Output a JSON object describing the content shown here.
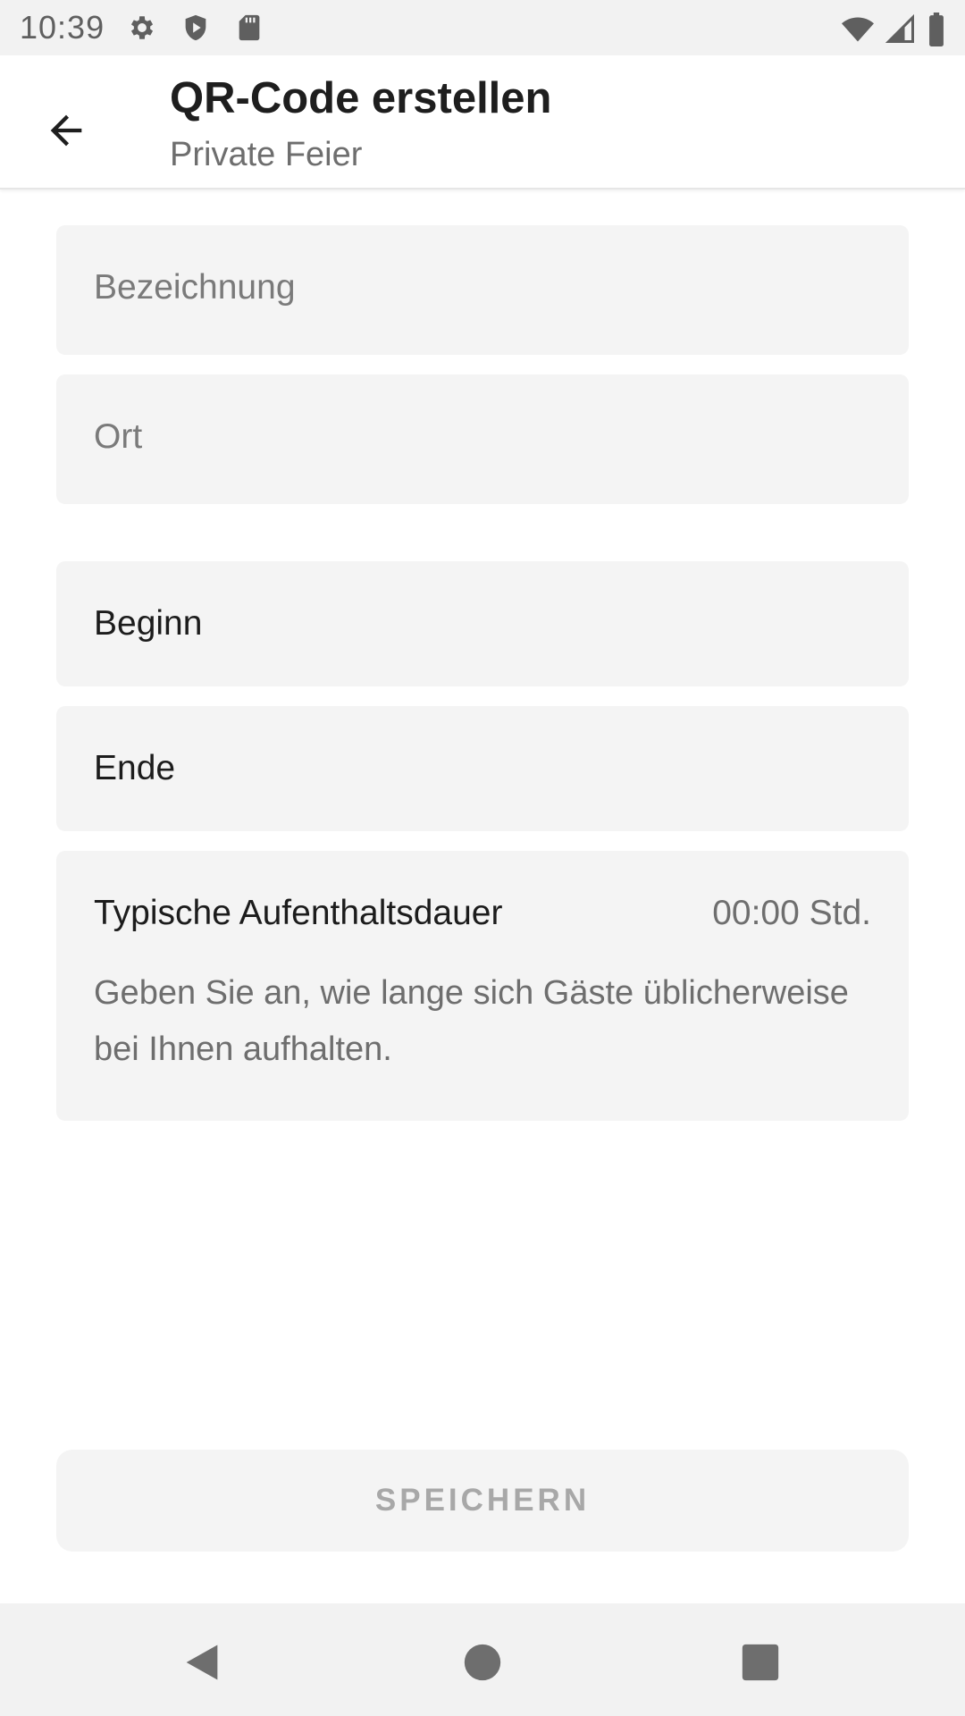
{
  "status_bar": {
    "time": "10:39",
    "left_icons": [
      "settings-icon",
      "shield-icon",
      "sd-card-icon"
    ],
    "right_icons": [
      "wifi-icon",
      "signal-icon",
      "battery-icon"
    ]
  },
  "app_bar": {
    "title": "QR-Code erstellen",
    "subtitle": "Private Feier",
    "back_icon": "arrow-back-icon"
  },
  "form": {
    "bezeichnung_placeholder": "Bezeichnung",
    "ort_placeholder": "Ort",
    "beginn_label": "Beginn",
    "ende_label": "Ende",
    "dauer_label": "Typische Aufenthaltsdauer",
    "dauer_value": "00:00 Std.",
    "dauer_help": "Geben Sie an, wie lange sich Gäste üblicherweise bei Ihnen aufhalten."
  },
  "actions": {
    "save_label": "SPEICHERN"
  },
  "nav_bar": {
    "icons": [
      "back-triangle-icon",
      "home-circle-icon",
      "recents-square-icon"
    ]
  },
  "colors": {
    "field_background": "#f4f4f4",
    "bar_background": "#f2f2f2",
    "disabled_text": "#a8a8a8"
  }
}
